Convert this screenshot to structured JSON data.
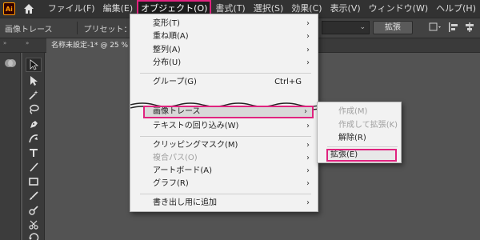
{
  "app": {
    "logo_text": "Ai"
  },
  "menubar": {
    "items": [
      {
        "label": "ファイル(F)"
      },
      {
        "label": "編集(E)"
      },
      {
        "label": "オブジェクト(O)"
      },
      {
        "label": "書式(T)"
      },
      {
        "label": "選択(S)"
      },
      {
        "label": "効果(C)"
      },
      {
        "label": "表示(V)"
      },
      {
        "label": "ウィンドウ(W)"
      },
      {
        "label": "ヘルプ(H)"
      }
    ]
  },
  "controlbar": {
    "mode_label": "画像トレース",
    "preset_label": "プリセット：",
    "expand_button": "拡張"
  },
  "document": {
    "tab_title": "名称未設定-1* @ 25 % ("
  },
  "object_menu": {
    "items": [
      {
        "label": "変形(T)",
        "arrow": "›"
      },
      {
        "label": "重ね順(A)",
        "arrow": "›"
      },
      {
        "label": "整列(A)",
        "arrow": "›"
      },
      {
        "label": "分布(U)",
        "arrow": "›"
      },
      {
        "label": "グループ(G)",
        "shortcut": "Ctrl+G"
      },
      {
        "label": "画像トレース",
        "arrow": "›"
      },
      {
        "label": "テキストの回り込み(W)",
        "arrow": "›"
      },
      {
        "label": "クリッピングマスク(M)",
        "arrow": "›"
      },
      {
        "label": "複合パス(O)",
        "arrow": "›"
      },
      {
        "label": "アートボード(A)",
        "arrow": "›"
      },
      {
        "label": "グラフ(R)",
        "arrow": "›"
      },
      {
        "label": "書き出し用に追加",
        "arrow": "›"
      }
    ]
  },
  "trace_submenu": {
    "items": [
      {
        "label": "作成(M)"
      },
      {
        "label": "作成して拡張(K)"
      },
      {
        "label": "解除(R)"
      },
      {
        "label": "拡張(E)"
      }
    ]
  },
  "colors": {
    "highlight": "#e0237f",
    "menu_bg": "#f2f2f2",
    "ui_dark": "#323232"
  },
  "icons": [
    "home-icon",
    "panel-icon",
    "selection-tool-icon",
    "direct-selection-tool-icon",
    "magic-wand-icon",
    "lasso-icon",
    "pen-tool-icon",
    "curvature-tool-icon",
    "type-tool-icon",
    "line-tool-icon",
    "rectangle-tool-icon",
    "paintbrush-tool-icon",
    "shaper-tool-icon",
    "scissors-tool-icon",
    "rotate-tool-icon"
  ]
}
